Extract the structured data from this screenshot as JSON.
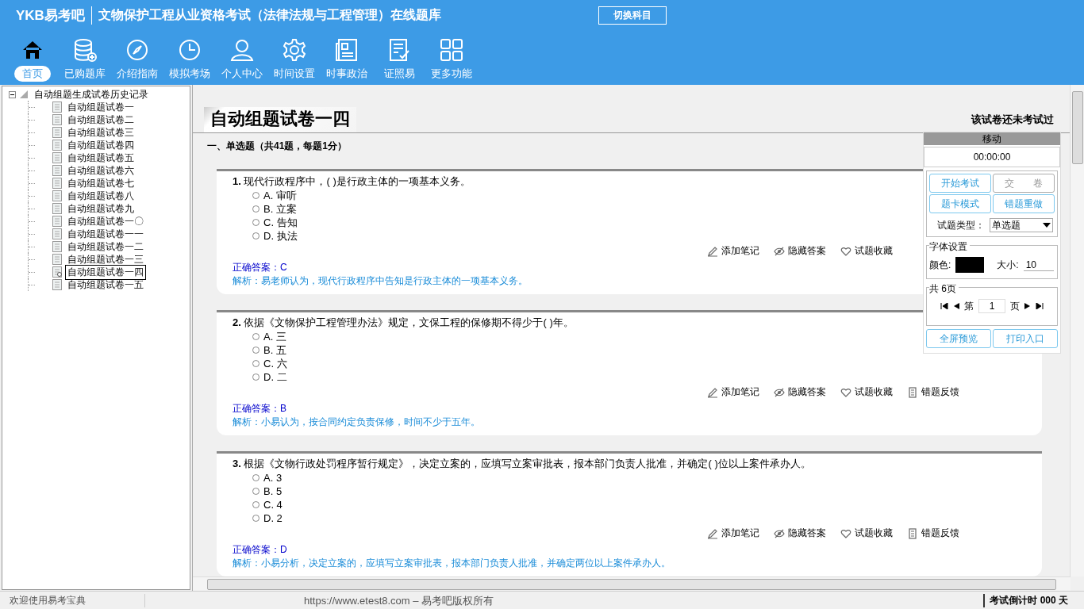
{
  "header": {
    "logo": "YKB易考吧",
    "title": "文物保护工程从业资格考试（法律法规与工程管理）在线题库",
    "switch_button": "切换科目",
    "nav": [
      {
        "label": "首页",
        "selected": true
      },
      {
        "label": "已购题库",
        "selected": false
      },
      {
        "label": "介绍指南",
        "selected": false
      },
      {
        "label": "模拟考场",
        "selected": false
      },
      {
        "label": "个人中心",
        "selected": false
      },
      {
        "label": "时间设置",
        "selected": false
      },
      {
        "label": "时事政治",
        "selected": false
      },
      {
        "label": "证照易",
        "selected": false
      },
      {
        "label": "更多功能",
        "selected": false
      }
    ]
  },
  "tree": {
    "label": "自动组题生成试卷历史记录",
    "expanded": true,
    "children": [
      {
        "label": "自动组题试卷一",
        "selected": false
      },
      {
        "label": "自动组题试卷二",
        "selected": false
      },
      {
        "label": "自动组题试卷三",
        "selected": false
      },
      {
        "label": "自动组题试卷四",
        "selected": false
      },
      {
        "label": "自动组题试卷五",
        "selected": false
      },
      {
        "label": "自动组题试卷六",
        "selected": false
      },
      {
        "label": "自动组题试卷七",
        "selected": false
      },
      {
        "label": "自动组题试卷八",
        "selected": false
      },
      {
        "label": "自动组题试卷九",
        "selected": false
      },
      {
        "label": "自动组题试卷一〇",
        "selected": false
      },
      {
        "label": "自动组题试卷一一",
        "selected": false
      },
      {
        "label": "自动组题试卷一二",
        "selected": false
      },
      {
        "label": "自动组题试卷一三",
        "selected": false
      },
      {
        "label": "自动组题试卷一四",
        "selected": true
      },
      {
        "label": "自动组题试卷一五",
        "selected": false
      }
    ]
  },
  "paper": {
    "title": "自动组题试卷一四",
    "status": "该试卷还未考试过",
    "section": "一、单选题（共41题，每题1分）",
    "questions": [
      {
        "number": "1.",
        "text": "现代行政程序中，( )是行政主体的一项基本义务。",
        "options": [
          {
            "label": "A. 审听",
            "selected": false
          },
          {
            "label": "B. 立案",
            "selected": false
          },
          {
            "label": "C. 告知",
            "selected": false
          },
          {
            "label": "D. 执法",
            "selected": false
          }
        ],
        "actions": [
          "添加笔记",
          "隐藏答案",
          "试题收藏"
        ],
        "answer_label": "正确答案：",
        "answer": "C",
        "explanation": "解析：易老师认为，现代行政程序中告知是行政主体的一项基本义务。"
      },
      {
        "number": "2.",
        "text": "依据《文物保护工程管理办法》规定，文保工程的保修期不得少于( )年。",
        "options": [
          {
            "label": "A. 三",
            "selected": false
          },
          {
            "label": "B. 五",
            "selected": false
          },
          {
            "label": "C. 六",
            "selected": false
          },
          {
            "label": "D. 二",
            "selected": false
          }
        ],
        "actions": [
          "添加笔记",
          "隐藏答案",
          "试题收藏",
          "错题反馈"
        ],
        "answer_label": "正确答案：",
        "answer": "B",
        "explanation": "解析：小易认为，按合同约定负责保修，时间不少于五年。"
      },
      {
        "number": "3.",
        "text": "根据《文物行政处罚程序暂行规定》，决定立案的，应填写立案审批表，报本部门负责人批准，并确定( )位以上案件承办人。",
        "options": [
          {
            "label": "A. 3",
            "selected": false
          },
          {
            "label": "B. 5",
            "selected": false
          },
          {
            "label": "C. 4",
            "selected": false
          },
          {
            "label": "D. 2",
            "selected": false
          }
        ],
        "actions": [
          "添加笔记",
          "隐藏答案",
          "试题收藏",
          "错题反馈"
        ],
        "answer_label": "正确答案：",
        "answer": "D",
        "explanation": "解析：小易分析，决定立案的，应填写立案审批表，报本部门负责人批准，并确定两位以上案件承办人。"
      }
    ]
  },
  "panel": {
    "handle": "移动",
    "timer": "00:00:00",
    "buttons": [
      {
        "label": "开始考试",
        "disabled": false
      },
      {
        "label": "交　　卷",
        "disabled": true
      },
      {
        "label": "题卡模式",
        "disabled": false
      },
      {
        "label": "错题重做",
        "disabled": false
      }
    ],
    "type_label": "试题类型：",
    "type_value": "单选题",
    "font_legend": "字体设置",
    "color_label": "颜色:",
    "size_label": "大小:",
    "size_value": "10",
    "pages_legend": "共 6页",
    "page_prefix": "第",
    "page": "1",
    "page_suffix": "页",
    "bottom_buttons": [
      "全屏预览",
      "打印入口"
    ]
  },
  "status_bar": {
    "welcome": "欢迎使用易考宝典",
    "copyright": "https://www.etest8.com – 易考吧版权所有",
    "countdown": "考试倒计时 000 天"
  }
}
